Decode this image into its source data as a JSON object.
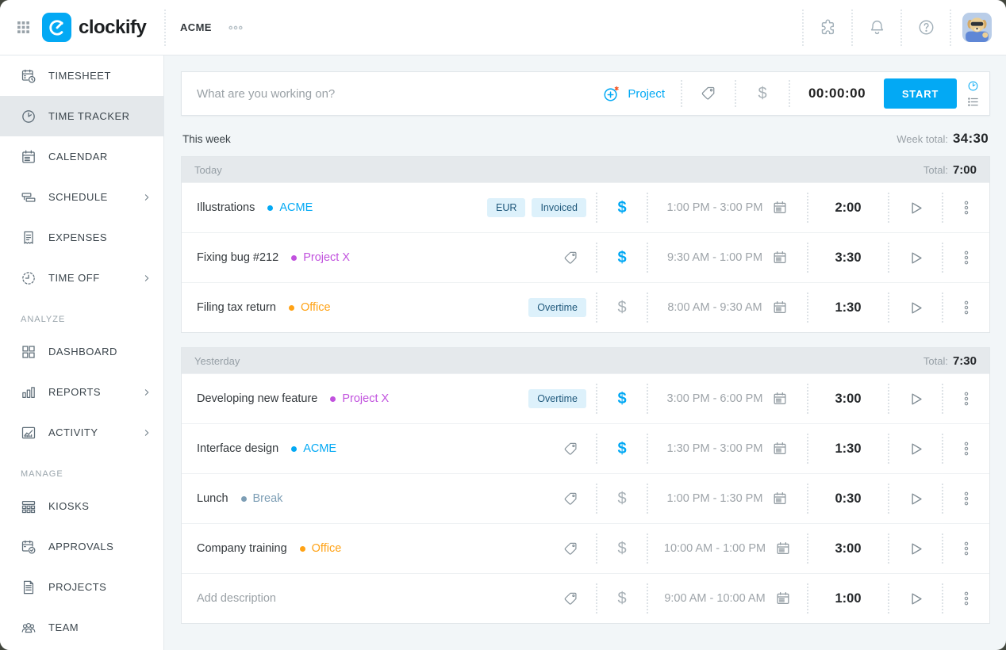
{
  "colors": {
    "accent": "#03A9F4",
    "badge_bg": "#DDF1FB",
    "badge_text": "#1F587B"
  },
  "header": {
    "app_name": "clockify",
    "workspace": "ACME"
  },
  "tracker": {
    "placeholder": "What are you working on?",
    "project_button": "Project",
    "timer": "00:00:00",
    "start_button": "START"
  },
  "week": {
    "label": "This week",
    "total_label": "Week total:",
    "total": "34:30"
  },
  "groups": [
    {
      "label": "Today",
      "total_label": "Total:",
      "total": "7:00",
      "entries": [
        {
          "description": "Illustrations",
          "project": "ACME",
          "project_color": "#03A9F4",
          "badges": [
            "EUR",
            "Invoiced"
          ],
          "billable": true,
          "time_range": "1:00 PM - 3:00 PM",
          "duration": "2:00"
        },
        {
          "description": "Fixing bug #212",
          "project": "Project X",
          "project_color": "#C152DE",
          "badges": [],
          "billable": true,
          "time_range": "9:30 AM - 1:00 PM",
          "duration": "3:30"
        },
        {
          "description": "Filing tax return",
          "project": "Office",
          "project_color": "#FFA215",
          "badges": [
            "Overtime"
          ],
          "billable": false,
          "time_range": "8:00 AM - 9:30 AM",
          "duration": "1:30"
        }
      ]
    },
    {
      "label": "Yesterday",
      "total_label": "Total:",
      "total": "7:30",
      "entries": [
        {
          "description": "Developing new feature",
          "project": "Project X",
          "project_color": "#C152DE",
          "badges": [
            "Overtime"
          ],
          "billable": true,
          "time_range": "3:00 PM - 6:00 PM",
          "duration": "3:00"
        },
        {
          "description": "Interface design",
          "project": "ACME",
          "project_color": "#03A9F4",
          "badges": [],
          "billable": true,
          "time_range": "1:30 PM - 3:00 PM",
          "duration": "1:30"
        },
        {
          "description": "Lunch",
          "project": "Break",
          "project_color": "#7D9EB5",
          "badges": [],
          "billable": false,
          "time_range": "1:00 PM - 1:30 PM",
          "duration": "0:30"
        },
        {
          "description": "Company training",
          "project": "Office",
          "project_color": "#FFA215",
          "badges": [],
          "billable": false,
          "time_range": "10:00 AM - 1:00 PM",
          "duration": "3:00"
        },
        {
          "description": "Add description",
          "placeholder": true,
          "badges": [],
          "billable": false,
          "time_range": "9:00 AM - 10:00 AM",
          "duration": "1:00"
        }
      ]
    }
  ],
  "sidebar": {
    "primary": [
      {
        "label": "TIMESHEET"
      },
      {
        "label": "TIME TRACKER",
        "active": true
      },
      {
        "label": "CALENDAR"
      },
      {
        "label": "SCHEDULE",
        "expandable": true
      },
      {
        "label": "EXPENSES"
      },
      {
        "label": "TIME OFF",
        "expandable": true
      }
    ],
    "analyze_title": "ANALYZE",
    "analyze": [
      {
        "label": "DASHBOARD"
      },
      {
        "label": "REPORTS",
        "expandable": true
      },
      {
        "label": "ACTIVITY",
        "expandable": true
      }
    ],
    "manage_title": "MANAGE",
    "manage": [
      {
        "label": "KIOSKS"
      },
      {
        "label": "APPROVALS"
      },
      {
        "label": "PROJECTS"
      },
      {
        "label": "TEAM"
      }
    ]
  }
}
